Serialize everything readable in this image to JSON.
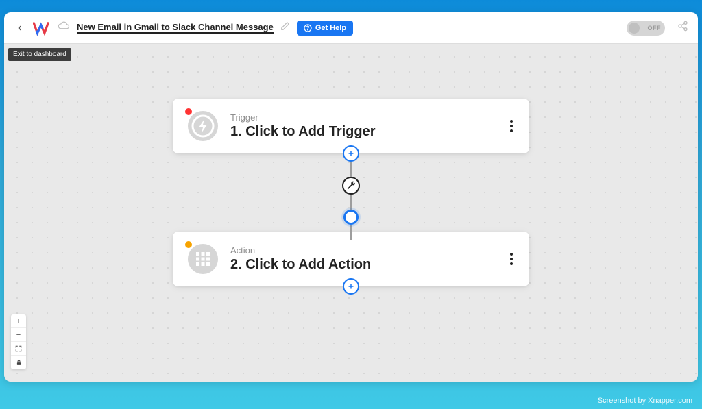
{
  "header": {
    "flow_title": "New Email in Gmail to Slack Channel Message",
    "get_help_label": "Get Help",
    "toggle_label": "OFF"
  },
  "tooltip": {
    "exit_label": "Exit to dashboard"
  },
  "flow": {
    "trigger": {
      "label": "Trigger",
      "title": "1. Click to Add Trigger",
      "status": "red"
    },
    "action": {
      "label": "Action",
      "title": "2. Click to Add Action",
      "status": "orange"
    }
  },
  "zoom": {
    "in": "+",
    "out": "−",
    "fit": "⤢",
    "lock": "🔒"
  },
  "watermark": "Screenshot by Xnapper.com"
}
